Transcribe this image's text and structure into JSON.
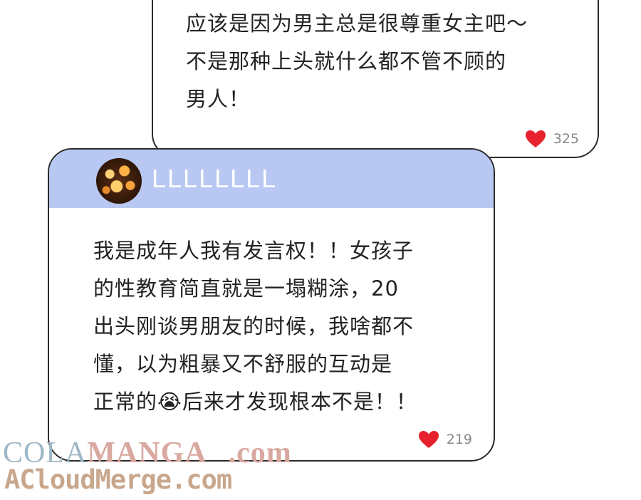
{
  "comments": [
    {
      "text": "应该是因为男主总是很尊重女主吧～\n不是那种上头就什么都不管不顾的\n男人！",
      "likes": "325"
    },
    {
      "username": "LLLLLLLL",
      "text": "我是成年人我有发言权！！女孩子\n的性教育简直就是一塌糊涂，20\n出头刚谈男朋友的时候，我啥都不\n懂，以为粗暴又不舒服的互动是\n正常的😭后来才发现根本不是！！",
      "likes": "219"
    }
  ],
  "watermark": {
    "line1_part1": "COLA",
    "line1_part2": "MANGA",
    "line1_part3": ".com",
    "line2": "ACloudMerge.com"
  },
  "colors": {
    "header_bg": "#b8c8f2",
    "heart": "#e8212e",
    "border": "#2b2b2b"
  },
  "icons": {
    "like": "heart-icon",
    "avatar": "bokeh-lights-avatar"
  }
}
